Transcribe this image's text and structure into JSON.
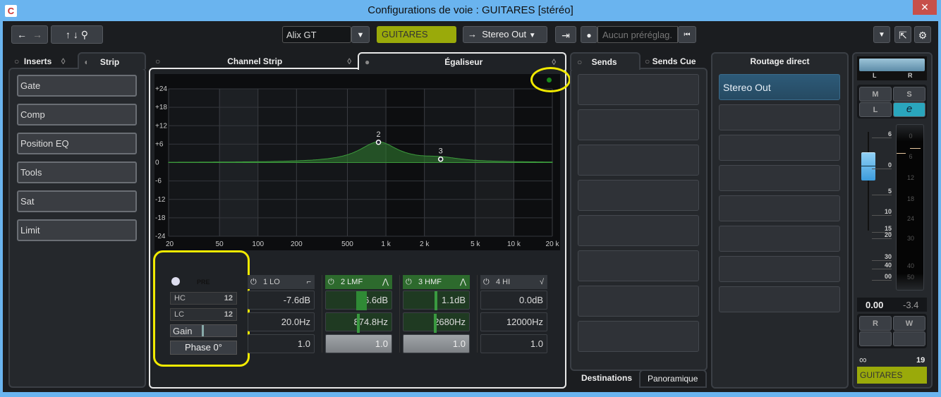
{
  "window": {
    "title": "Configurations de voie : GUITARES [stéréo]",
    "close": "✕",
    "app_icon": "C"
  },
  "toolbar": {
    "back": "←",
    "forward": "→",
    "up": "↑",
    "down": "↓",
    "search": "⚲",
    "preset_name": "Alix GT",
    "dropdown": "▼",
    "channel_name": "GUITARES",
    "output_arrow": "→",
    "output": "Stereo Out",
    "route_icon": "⇥",
    "preset_placeholder": "Aucun préréglag.",
    "preset_nav": "⏮",
    "menu": "▼",
    "settings": "⚙",
    "export": "⇱",
    "channel_color": "#9aaa0a"
  },
  "left_tabs": {
    "inserts": "Inserts",
    "strip": "Strip"
  },
  "strip_items": [
    "Gate",
    "Comp",
    "Position EQ",
    "Tools",
    "Sat",
    "Limit"
  ],
  "center_tabs": {
    "channel_strip": "Channel Strip",
    "eq": "Égaliseur"
  },
  "pre": {
    "label": "PRE",
    "hc": "HC",
    "hc_slope": "12",
    "lc": "LC",
    "lc_slope": "12",
    "gain": "Gain",
    "phase": "Phase 0°"
  },
  "bands": [
    {
      "name": "1 LO",
      "on": false,
      "shape": "⌐",
      "gain": "-7.6dB",
      "freq": "20.0Hz",
      "q": "1.0"
    },
    {
      "name": "2 LMF",
      "on": true,
      "shape": "⋀",
      "gain": "6.6dB",
      "freq": "874.8Hz",
      "q": "1.0"
    },
    {
      "name": "3 HMF",
      "on": true,
      "shape": "⋀",
      "gain": "1.1dB",
      "freq": "2680Hz",
      "q": "1.0"
    },
    {
      "name": "4 HI",
      "on": false,
      "shape": "√",
      "gain": "0.0dB",
      "freq": "12000Hz",
      "q": "1.0"
    }
  ],
  "chart_data": {
    "type": "line",
    "x_scale": "log",
    "xlim": [
      20,
      20000
    ],
    "ylim": [
      -24,
      24
    ],
    "x_ticks": [
      "20",
      "50",
      "100",
      "200",
      "500",
      "1 k",
      "2 k",
      "5 k",
      "10 k",
      "20 k"
    ],
    "x_tick_values": [
      20,
      50,
      100,
      200,
      500,
      1000,
      2000,
      5000,
      10000,
      20000
    ],
    "y_ticks": [
      "+24",
      "+18",
      "+12",
      "+6",
      "0",
      "-6",
      "-12",
      "-18",
      "-24"
    ],
    "y_tick_values": [
      24,
      18,
      12,
      6,
      0,
      -6,
      -12,
      -18,
      -24
    ],
    "points": [
      {
        "label": "2",
        "freq": 874.8,
        "gain": 6.6,
        "q": 1.0
      },
      {
        "label": "3",
        "freq": 2680,
        "gain": 1.1,
        "q": 1.0
      }
    ],
    "curve_color": "#2f7a2f",
    "grid": true
  },
  "sends_tabs": {
    "sends": "Sends",
    "sends_cue": "Sends Cue",
    "destinations": "Destinations",
    "pan": "Panoramique"
  },
  "routing": {
    "title": "Routage direct",
    "items": [
      "Stereo Out",
      "",
      "",
      "",
      "",
      "",
      "",
      ""
    ]
  },
  "fader": {
    "pan_l": "L",
    "pan_r": "R",
    "mute": "M",
    "solo": "S",
    "listen": "L",
    "edit": "e",
    "scale": [
      "6",
      "0",
      "5",
      "10",
      "15",
      "20",
      "30",
      "40",
      "00"
    ],
    "meter_scale": [
      "0",
      "6",
      "12",
      "18",
      "24",
      "30",
      "40",
      "50"
    ],
    "volume": "0.00",
    "peak": "-3.4",
    "read": "R",
    "write": "W",
    "link_icon": "∞",
    "channel_number": "19",
    "channel_name": "GUITARES",
    "fader_level_db": 0
  }
}
